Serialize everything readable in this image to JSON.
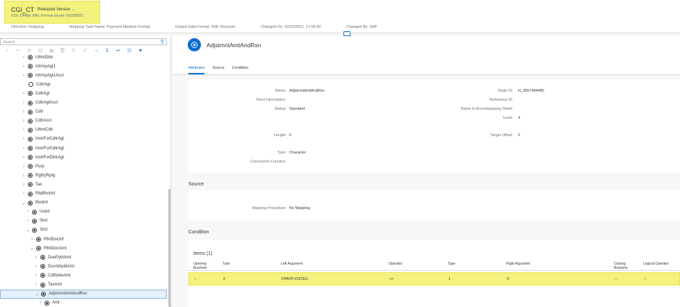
{
  "header": {
    "title": "CGI_CT",
    "version_label": "Released Version",
    "subtitle": "CGI: DMEE XML Format as per ISO20022",
    "meta": [
      "Direction: Outgoing",
      "Mapping Type Name: Payment Medium Format",
      "Output Data Format: XML Structure",
      "Changed On: 10/12/2021, 17:04:39",
      "Changed By: SAP"
    ]
  },
  "search": {
    "placeholder": "Search"
  },
  "toolbar": {
    "icons": [
      "add-icon",
      "cut-icon",
      "copy-icon",
      "paste-icon",
      "paste-special-icon",
      "delete-icon",
      "move-up-icon",
      "move-down-icon",
      "indent-icon",
      "collapse-all-icon",
      "expand-all-icon",
      "column-settings-icon",
      "filter-icon"
    ]
  },
  "tree": [
    {
      "label": "UltmtDbtr",
      "level": 0,
      "state": "collapsed",
      "icon": "node-icon"
    },
    {
      "label": "IntrmyAgt1",
      "level": 0,
      "state": "collapsed",
      "icon": "node-icon"
    },
    {
      "label": "IntrmyAgt1Acct",
      "level": 0,
      "state": "collapsed",
      "icon": "node-icon"
    },
    {
      "label": "CdtrAgt",
      "level": 0,
      "state": "none",
      "icon": "reference-node-icon"
    },
    {
      "label": "CdtrAgt",
      "level": 0,
      "state": "collapsed",
      "icon": "node-icon"
    },
    {
      "label": "CdtrAgtAcct",
      "level": 0,
      "state": "collapsed",
      "icon": "node-icon"
    },
    {
      "label": "Cdtr",
      "level": 0,
      "state": "collapsed",
      "icon": "node-icon"
    },
    {
      "label": "CdtrAcct",
      "level": 0,
      "state": "collapsed",
      "icon": "node-icon"
    },
    {
      "label": "UltmtCdtr",
      "level": 0,
      "state": "collapsed",
      "icon": "node-icon"
    },
    {
      "label": "InstrForCdtrAgt",
      "level": 0,
      "state": "collapsed",
      "icon": "node-icon"
    },
    {
      "label": "InstrForCdtrAgt",
      "level": 0,
      "state": "collapsed",
      "icon": "node-icon"
    },
    {
      "label": "InstrForDbtrAgt",
      "level": 0,
      "state": "collapsed",
      "icon": "node-icon"
    },
    {
      "label": "Purp",
      "level": 0,
      "state": "collapsed",
      "icon": "node-icon"
    },
    {
      "label": "RgltryRptg",
      "level": 0,
      "state": "collapsed",
      "icon": "node-icon"
    },
    {
      "label": "Tax",
      "level": 0,
      "state": "collapsed",
      "icon": "node-icon"
    },
    {
      "label": "RltdRmtInf",
      "level": 0,
      "state": "collapsed",
      "icon": "node-icon"
    },
    {
      "label": "RmtInf",
      "level": 0,
      "state": "expanded",
      "icon": "node-icon"
    },
    {
      "label": "Ustrd",
      "level": 1,
      "state": "collapsed",
      "icon": "node-icon"
    },
    {
      "label": "Strd",
      "level": 1,
      "state": "collapsed",
      "icon": "node-icon"
    },
    {
      "label": "Strd",
      "level": 1,
      "state": "expanded",
      "icon": "node-icon"
    },
    {
      "label": "RfrdDocInf",
      "level": 2,
      "state": "collapsed",
      "icon": "node-icon"
    },
    {
      "label": "RfrdDocAmt",
      "level": 2,
      "state": "expanded",
      "icon": "node-icon"
    },
    {
      "label": "DuePyblAmt",
      "level": 3,
      "state": "collapsed",
      "icon": "node-icon"
    },
    {
      "label": "DscntApldAmt",
      "level": 3,
      "state": "collapsed",
      "icon": "node-icon"
    },
    {
      "label": "CdtNoteAmt",
      "level": 3,
      "state": "collapsed",
      "icon": "node-icon"
    },
    {
      "label": "TaxAmt",
      "level": 3,
      "state": "collapsed",
      "icon": "node-icon"
    },
    {
      "label": "AdjstmntAmtAndRsn",
      "level": 3,
      "state": "expanded",
      "icon": "node-icon",
      "selected": true
    },
    {
      "label": "Amt",
      "level": 4,
      "state": "collapsed",
      "icon": "node-icon"
    }
  ],
  "detail": {
    "title": "AdjstmntAmtAndRsn",
    "tabs": [
      "Attributes",
      "Source",
      "Condition"
    ],
    "attributes": {
      "name_label": "Name:",
      "name": "AdjstmntAmtAndRsn",
      "short_desc_label": "Short Description:",
      "short_desc": "",
      "status_label": "Status:",
      "status": "Standard",
      "node_id_label": "Node ID:",
      "node_id": "N_3057494480",
      "ref_id_label": "Reference ID:",
      "ref_id": "",
      "name_sheet_label": "Name in Accompanying Sheet:",
      "name_sheet": "",
      "level_label": "Level:",
      "level": "4",
      "length_label": "Length:",
      "length": "0",
      "target_offset_label": "Target Offset:",
      "target_offset": "0",
      "type_label": "Type:",
      "type": "Character",
      "conv_func_label": "Conversion Function:",
      "conv_func": ""
    },
    "source": {
      "title": "Source",
      "mapping_label": "Mapping Procedure:",
      "mapping": "No Mapping"
    },
    "condition": {
      "title": "Condition",
      "items_title": "Items (1)",
      "columns": [
        "Opening Brackets",
        "Type",
        "Left Argument",
        "Operator",
        "Type",
        "Right Argument",
        "Closing Brackets",
        "Logical Operator"
      ],
      "rows": [
        [
          "--",
          "2",
          "FPAYP-OSTEU",
          "<>",
          "1",
          "0",
          "--",
          "--"
        ]
      ]
    }
  },
  "colors": {
    "accent": "#0a6ed1",
    "highlight": "#f4f27d"
  }
}
